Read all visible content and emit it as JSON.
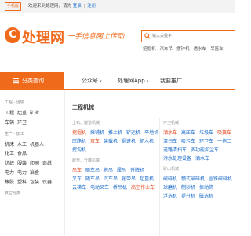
{
  "topbar": {
    "mobile_label": "手机版",
    "welcome": "欢迎来到处理网，请先",
    "login": "登录",
    "sep": "|",
    "register": "注册"
  },
  "header": {
    "logo_mark": "C",
    "logo_text": "处理网",
    "slogan": "一手信息网上传动",
    "search_placeholder": "输入关键字",
    "hotwords": [
      "挖掘机",
      "汽车吊",
      "摆钟机",
      "透水车",
      "吊篮车"
    ]
  },
  "nav": {
    "category_label": "分类查询",
    "items": [
      {
        "label": "公众号",
        "caret": "▾"
      },
      {
        "label": "处理网App",
        "caret": "▾"
      },
      {
        "label": "我要推广",
        "caret": ""
      }
    ]
  },
  "sidebar": {
    "groups": [
      {
        "title": "工程 · 运输",
        "lines": [
          [
            "工程",
            "起重",
            "矿业"
          ],
          [
            "车辆",
            "环卫"
          ]
        ]
      },
      {
        "title": "生产 · 加工",
        "lines": [
          [
            "机床",
            "木工",
            "机器人"
          ],
          [
            "化工",
            "食品"
          ],
          [
            "纺织",
            "服装",
            "印刷",
            "造纸"
          ],
          [
            "电力",
            "电力",
            "冶金"
          ],
          [
            "橡胶",
            "塑料",
            "包装",
            "仪器"
          ]
        ]
      },
      {
        "title": "其它分类",
        "lines": []
      }
    ]
  },
  "main": {
    "section_title": "工程机械",
    "blocks": [
      {
        "title": "土石、隧道机械",
        "rows": [
          [
            {
              "t": "挖掘机",
              "h": true
            },
            {
              "t": "摊铺机",
              "h": false
            },
            {
              "t": "推土机",
              "h": false
            },
            {
              "t": "铲运机",
              "h": false
            },
            {
              "t": "平地机",
              "h": false
            }
          ],
          [
            {
              "t": "压路机",
              "h": false
            },
            {
              "t": "双车",
              "h": true
            },
            {
              "t": "装载机",
              "h": false
            },
            {
              "t": "掘进机",
              "h": false
            },
            {
              "t": "抓木机",
              "h": false
            }
          ],
          [
            {
              "t": "挖沟机",
              "h": false
            }
          ]
        ]
      },
      {
        "title": "起重、升降机械",
        "rows": [
          [
            {
              "t": "吊车",
              "h": true
            },
            {
              "t": "随车吊",
              "h": false
            },
            {
              "t": "塔吊",
              "h": false
            },
            {
              "t": "履吊",
              "h": false
            },
            {
              "t": "升降机",
              "h": false
            }
          ],
          [
            {
              "t": "叉车",
              "h": false
            },
            {
              "t": "随车吊",
              "h": false
            },
            {
              "t": "汽车吊",
              "h": false
            },
            {
              "t": "履带吊",
              "h": false
            },
            {
              "t": "起重机",
              "h": false
            }
          ],
          [
            {
              "t": "云梯车",
              "h": false
            },
            {
              "t": "电动叉车",
              "h": false
            },
            {
              "t": "桥吊机",
              "h": false
            },
            {
              "t": "高空作业车",
              "h": true
            }
          ]
        ]
      },
      {
        "title": "环卫机械",
        "rows": [
          [
            {
              "t": "洒水车",
              "h": true
            },
            {
              "t": "高压车",
              "h": false
            },
            {
              "t": "垃圾车",
              "h": false
            },
            {
              "t": "吸粪车",
              "h": true
            }
          ],
          [
            {
              "t": "清扫车",
              "h": false
            },
            {
              "t": "吸污车",
              "h": false
            },
            {
              "t": "环卫车",
              "h": false
            },
            {
              "t": "一拖二",
              "h": false
            }
          ],
          [
            {
              "t": "道路清扫车",
              "h": false
            },
            {
              "t": "多功能抑尘车",
              "h": false
            }
          ],
          [
            {
              "t": "污水处理设备",
              "h": false
            },
            {
              "t": "洒水车",
              "h": false
            }
          ]
        ]
      },
      {
        "title": "矿山机械",
        "rows": [
          [
            {
              "t": "破碎机",
              "h": false
            },
            {
              "t": "颚式破碎机",
              "h": false
            },
            {
              "t": "圆锥破碎机",
              "h": false
            }
          ],
          [
            {
              "t": "球磨机",
              "h": false
            },
            {
              "t": "制砂机",
              "h": false
            },
            {
              "t": "振动筛",
              "h": false
            }
          ],
          [
            {
              "t": "浮选机",
              "h": false
            },
            {
              "t": "提升机",
              "h": false
            },
            {
              "t": "磁选机",
              "h": false
            }
          ]
        ]
      }
    ]
  },
  "colors": {
    "brand": "#f06a1c",
    "link": "#1a6bc9",
    "highlight": "#e34a1e"
  }
}
